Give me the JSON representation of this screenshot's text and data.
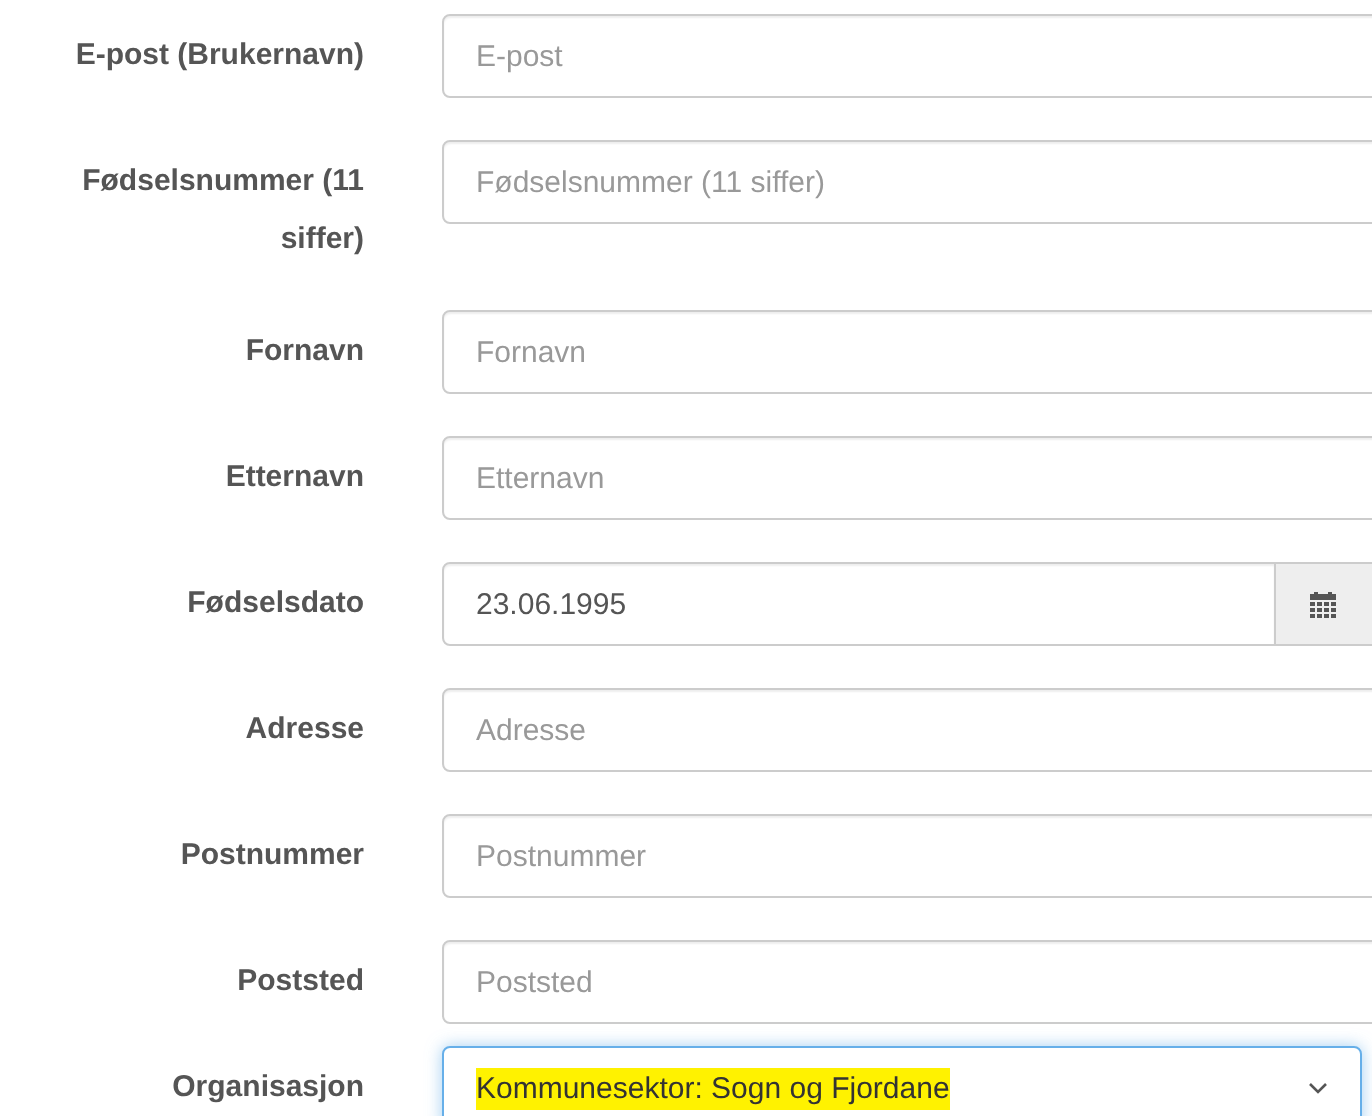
{
  "fields": [
    {
      "kind": "text",
      "label": "E-post (Brukernavn)",
      "placeholder": "E-post"
    },
    {
      "kind": "text",
      "label": "Fødselsnummer (11 siffer)",
      "placeholder": "Fødselsnummer (11 siffer)"
    },
    {
      "kind": "text",
      "label": "Fornavn",
      "placeholder": "Fornavn"
    },
    {
      "kind": "text",
      "label": "Etternavn",
      "placeholder": "Etternavn"
    },
    {
      "kind": "date",
      "label": "Fødselsdato",
      "value": "23.06.1995"
    },
    {
      "kind": "text",
      "label": "Adresse",
      "placeholder": "Adresse"
    },
    {
      "kind": "text",
      "label": "Postnummer",
      "placeholder": "Postnummer"
    },
    {
      "kind": "text",
      "label": "Poststed",
      "placeholder": "Poststed"
    },
    {
      "kind": "select",
      "label": "Organisasjon",
      "value": "Kommunesektor: Sogn og Fjordane",
      "focused": true,
      "highlighted": true
    }
  ]
}
